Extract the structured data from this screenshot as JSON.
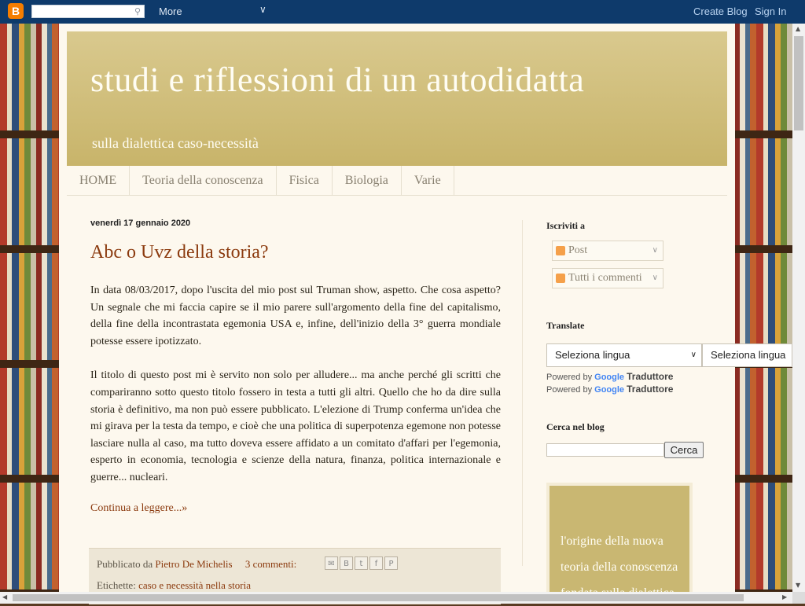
{
  "navbar": {
    "search_icon": "magnifier-icon",
    "more_label": "More",
    "create_blog": "Create Blog",
    "sign_in": "Sign In"
  },
  "header": {
    "title": "studi e riflessioni di un autodidatta",
    "description": "sulla dialettica caso-necessità"
  },
  "tabs": [
    "HOME",
    "Teoria della conoscenza",
    "Fisica",
    "Biologia",
    "Varie"
  ],
  "post": {
    "date": "venerdì 17 gennaio 2020",
    "title": "Abc o Uvz della storia?",
    "paragraphs": [
      "In data 08/03/2017, dopo l'uscita del mio post sul Truman show, aspetto. Che cosa aspetto? Un segnale che mi faccia capire se il mio parere sull'argomento della fine del capitalismo, della fine della incontrastata egemonia USA e, infine, dell'inizio della 3° guerra mondiale potesse essere ipotizzato.",
      "Il titolo di questo post mi è servito non solo per alludere... ma anche perché gli scritti che compariranno sotto questo titolo fossero in testa a tutti gli altri. Quello che ho da dire sulla storia è definitivo, ma non può essere pubblicato. L'elezione di Trump conferma un'idea che mi girava per la testa da tempo, e cioè che una politica di superpotenza egemone non potesse lasciare nulla al caso, ma tutto doveva essere affidato a un comitato d'affari per l'egemonia, esperto in economia, tecnologia e scienze della natura, finanza, politica internazionale e guerre... nucleari."
    ],
    "read_more": "Continua a leggere...»",
    "published_by": "Pubblicato da",
    "author": "Pietro De Michelis",
    "comments": "3 commenti:",
    "labels_prefix": "Etichette:",
    "label": "caso e necessità nella storia",
    "share_icons": [
      "email-icon",
      "blogger-icon",
      "twitter-icon",
      "facebook-icon",
      "pinterest-icon"
    ]
  },
  "sidebar": {
    "subscribe_title": "Iscriviti a",
    "feed_posts": "Post",
    "feed_comments": "Tutti i commenti",
    "translate_title": "Translate",
    "select_language": "Seleziona lingua",
    "powered_by": "Powered by",
    "google": "Google",
    "translator": "Traduttore",
    "search_title": "Cerca nel blog",
    "search_button": "Cerca",
    "promo_text": "l'origine della nuova teoria della conoscenza fondata sulla dialettica"
  }
}
